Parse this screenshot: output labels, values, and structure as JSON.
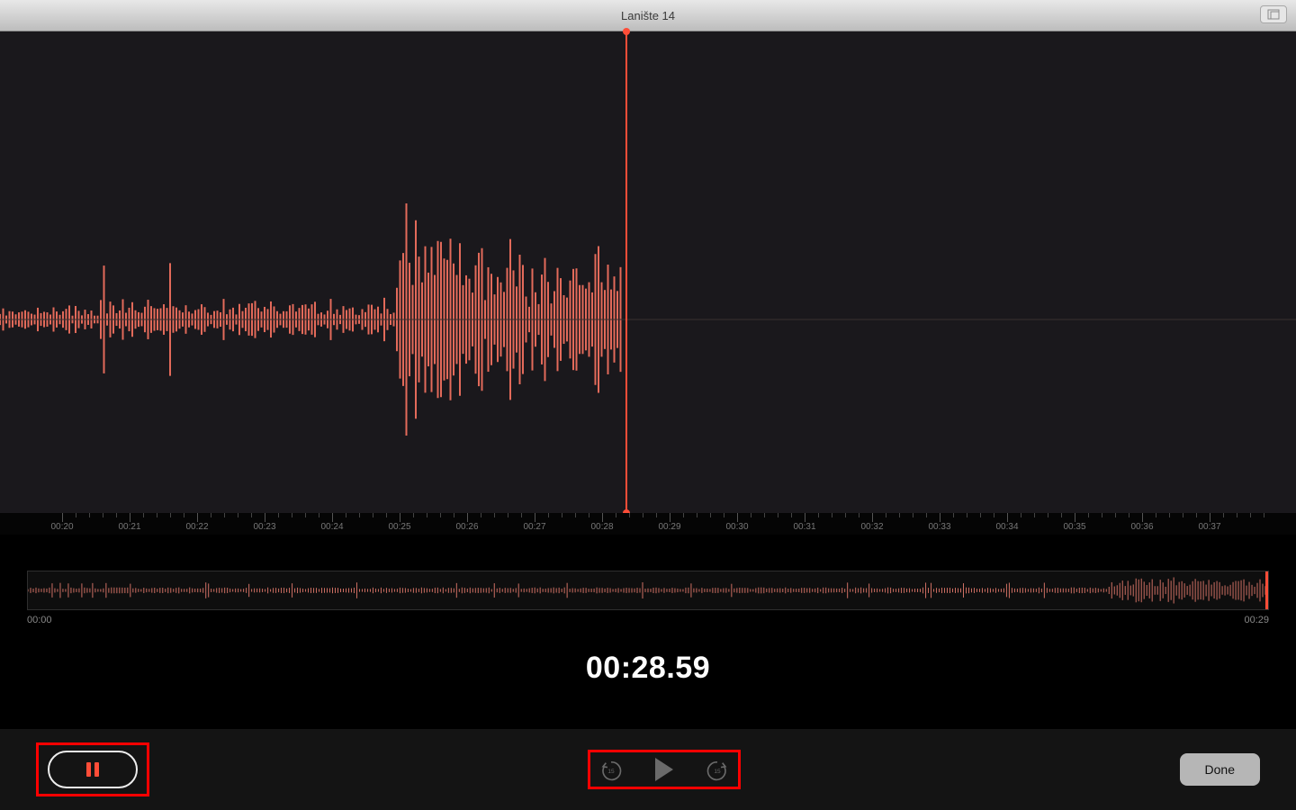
{
  "title": "Lanište 14",
  "ruler_labels": [
    "00:20",
    "00:21",
    "00:22",
    "00:23",
    "00:24",
    "00:25",
    "00:26",
    "00:27",
    "00:28",
    "00:29",
    "00:30",
    "00:31",
    "00:32",
    "00:33",
    "00:34",
    "00:35",
    "00:36",
    "00:37"
  ],
  "overview": {
    "start": "00:00",
    "end": "00:29"
  },
  "timecode": "00:28.59",
  "skip_back_secs": "15",
  "skip_fwd_secs": "15",
  "done_label": "Done",
  "colors": {
    "accent": "#ff4d38",
    "highlight": "#ff0000"
  }
}
